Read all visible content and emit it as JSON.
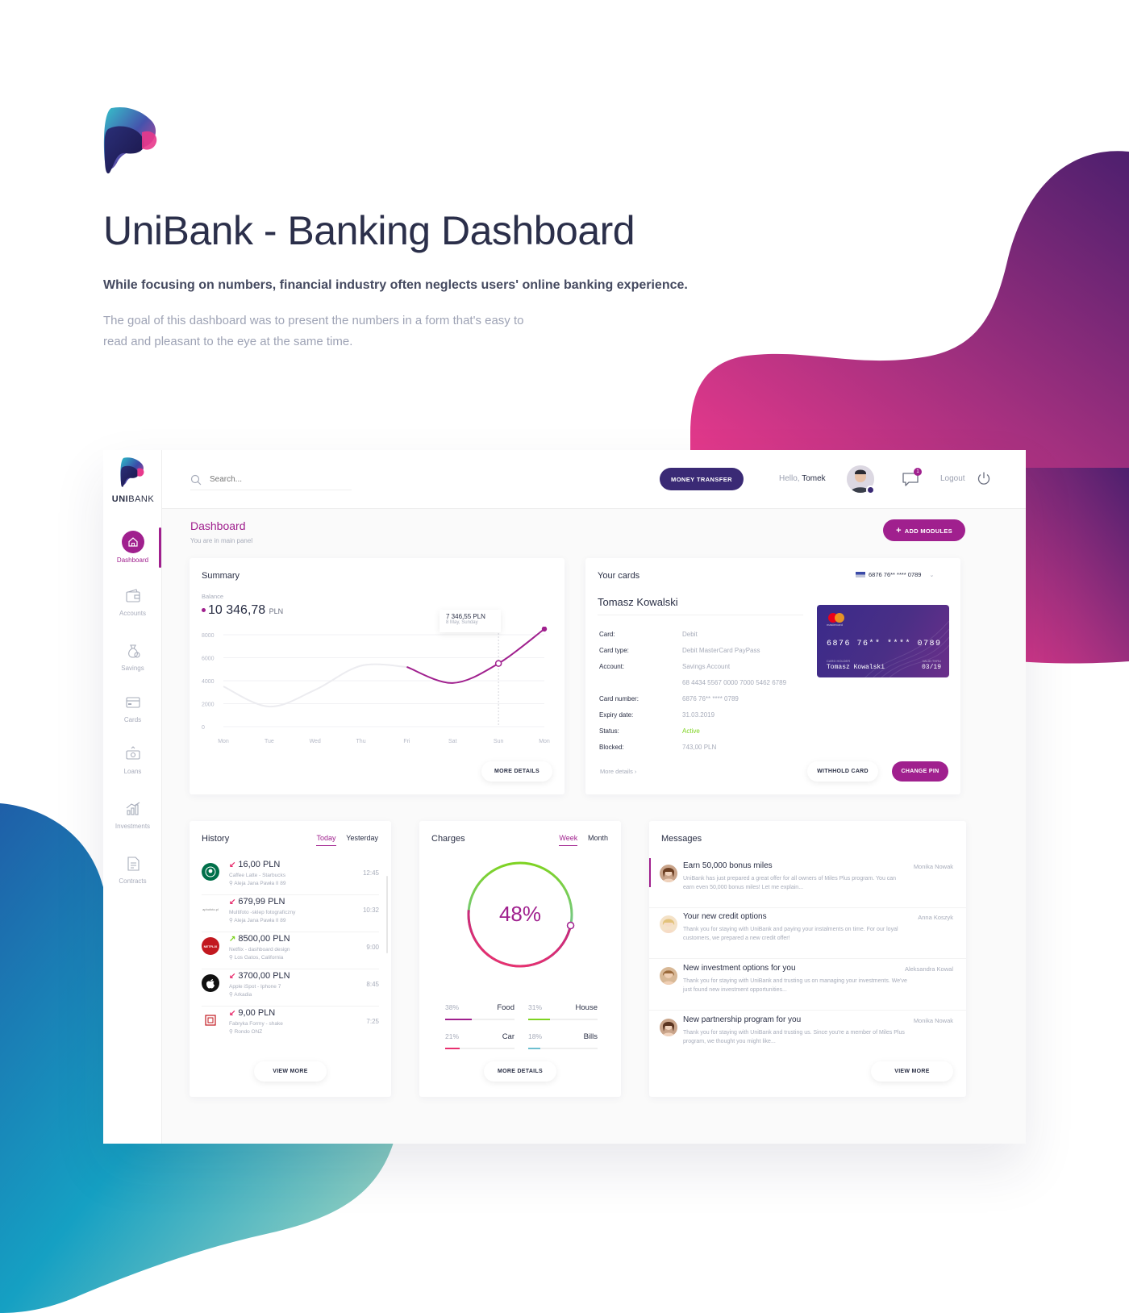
{
  "hero": {
    "title": "UniBank - Banking Dashboard",
    "lead": "While focusing on numbers, financial industry often neglects users' online banking experience.",
    "sub": "The goal of this dashboard was to present the numbers in a form that's easy to read and pleasant to the eye at the same time."
  },
  "brand": {
    "name_bold": "UNI",
    "name_rest": "BANK"
  },
  "topbar": {
    "search_placeholder": "Search...",
    "transfer_label": "MONEY TRANSFER",
    "hello": "Hello,",
    "user": "Tomek",
    "message_count": "1",
    "logout": "Logout"
  },
  "sidebar": {
    "items": [
      {
        "label": "Dashboard",
        "icon": "home-icon",
        "active": true
      },
      {
        "label": "Accounts",
        "icon": "wallet-icon"
      },
      {
        "label": "Savings",
        "icon": "moneybag-icon"
      },
      {
        "label": "Cards",
        "icon": "card-icon"
      },
      {
        "label": "Loans",
        "icon": "loan-icon"
      },
      {
        "label": "Investments",
        "icon": "chart-icon"
      },
      {
        "label": "Contracts",
        "icon": "document-icon"
      }
    ]
  },
  "page": {
    "title": "Dashboard",
    "subtitle": "You are in main panel",
    "add_modules": "ADD MODULES"
  },
  "summary": {
    "title": "Summary",
    "balance_label": "Balance",
    "balance": "10 346,78",
    "currency": "PLN",
    "tooltip_value": "7 346,55 PLN",
    "tooltip_date": "8 May, Sunday",
    "more": "MORE DETAILS"
  },
  "chart_data": {
    "type": "line",
    "categories": [
      "Mon",
      "Tue",
      "Wed",
      "Thu",
      "Fri",
      "Sat",
      "Sun",
      "Mon"
    ],
    "yticks": [
      "8000",
      "6000",
      "4000",
      "2000",
      "0"
    ],
    "ylim": [
      0,
      8000
    ],
    "series": [
      {
        "values": [
          3500,
          1750,
          3200,
          5300,
          5200,
          3800,
          5500,
          8500
        ],
        "color": "#a0208e"
      }
    ],
    "grid": true,
    "legend": "none"
  },
  "cards": {
    "title": "Your cards",
    "selector": "6876 76** **** 0789",
    "holder": "Tomasz Kowalski",
    "rows": [
      {
        "k": "Card:",
        "v": "Debit"
      },
      {
        "k": "Card type:",
        "v": "Debit MasterCard PayPass"
      },
      {
        "k": "Account:",
        "v": "Savings Account"
      },
      {
        "k": "",
        "v": "68 4434 5567 0000 7000 5462 6789"
      },
      {
        "k": "Card number:",
        "v": "6876 76** **** 0789"
      },
      {
        "k": "Expiry date:",
        "v": "31.03.2019"
      },
      {
        "k": "Status:",
        "v": "Active"
      },
      {
        "k": "Blocked:",
        "v": "743,00 PLN"
      }
    ],
    "more": "More details ›",
    "withhold": "WITHHOLD CARD",
    "change_pin": "CHANGE PIN",
    "cc_brand": "mastercard",
    "cc_number": "6876 76** **** 0789",
    "cc_holder_label": "CARD HOLDER",
    "cc_holder": "Tomasz Kowalski",
    "cc_valid_label": "VALID THRU",
    "cc_valid": "03/19"
  },
  "history": {
    "title": "History",
    "tabs": [
      "Today",
      "Yesterday"
    ],
    "items": [
      {
        "amount": "16,00 PLN",
        "dir": "out",
        "desc": "Caffee Latte - Starbucks",
        "loc": "Aleja Jana Pawła II 89",
        "time": "12:45",
        "logo": "starbucks-icon"
      },
      {
        "amount": "679,99 PLN",
        "dir": "out",
        "desc": "Multifoto -sklep fotograficzny",
        "loc": "Aleja Jana Pawła II 89",
        "time": "10:32",
        "logo": "multifoto-icon",
        "logo_text": "aphofoto.pl"
      },
      {
        "amount": "8500,00 PLN",
        "dir": "in",
        "desc": "Netflix - dashboard design",
        "loc": "Los Gatos, California",
        "time": "9:00",
        "logo": "netflix-icon",
        "logo_text": "NETFLIX"
      },
      {
        "amount": "3700,00 PLN",
        "dir": "out",
        "desc": "Apple iSpot - Iphone 7",
        "loc": "Arkadia",
        "time": "8:45",
        "logo": "apple-icon"
      },
      {
        "amount": "9,00 PLN",
        "dir": "out",
        "desc": "Fabryka Formy - shake",
        "loc": "Rondo ONZ",
        "time": "7:25",
        "logo": "fabryka-icon"
      }
    ],
    "more": "VIEW MORE"
  },
  "charges": {
    "title": "Charges",
    "tabs": [
      "Week",
      "Month"
    ],
    "percent": "48%",
    "percent_value": 48,
    "items": [
      {
        "pct": "38%",
        "label": "Food",
        "value": 38,
        "color": "#a0208e"
      },
      {
        "pct": "31%",
        "label": "House",
        "value": 31,
        "color": "#7ed321"
      },
      {
        "pct": "21%",
        "label": "Car",
        "value": 21,
        "color": "#e8306f"
      },
      {
        "pct": "18%",
        "label": "Bills",
        "value": 18,
        "color": "#6dbfd0"
      }
    ],
    "more": "MORE DETAILS"
  },
  "messages": {
    "title": "Messages",
    "items": [
      {
        "title": "Earn 50,000 bonus miles",
        "author": "Monika Nowak",
        "body": "UniBank has just prepared a great offer for all owners of Miles Plus program. You can earn even 50,000 bonus miles! Let me explain..."
      },
      {
        "title": "Your new credit options",
        "author": "Anna Koszyk",
        "body": "Thank you for staying with UniBank and paying your instalments on time. For our loyal customers, we prepared a new credit offer!"
      },
      {
        "title": "New investment options for you",
        "author": "Aleksandra Kowal",
        "body": "Thank you for staying with UniBank and trusting us on managing your investments. We've just found new investment opportunities..."
      },
      {
        "title": "New partnership program for you",
        "author": "Monika Nowak",
        "body": "Thank you for staying with UniBank and trusting us. Since you're a member of Miles Plus program, we thought you might like..."
      }
    ],
    "more": "VIEW MORE"
  },
  "colors": {
    "accent": "#a0208e",
    "primary": "#3a2a75",
    "active": "#7ed321"
  }
}
